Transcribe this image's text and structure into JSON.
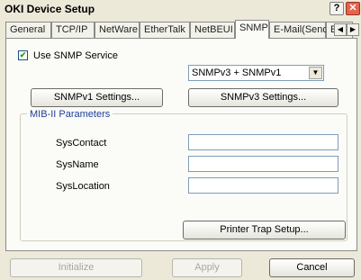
{
  "window": {
    "title": "OKI Device Setup",
    "help_glyph": "?",
    "close_glyph": "✕"
  },
  "tabs": [
    {
      "label": "General"
    },
    {
      "label": "TCP/IP"
    },
    {
      "label": "NetWare"
    },
    {
      "label": "EtherTalk"
    },
    {
      "label": "NetBEUI"
    },
    {
      "label": "SNMP"
    },
    {
      "label": "E-Mail(Send)"
    },
    {
      "label": "E-Mail("
    }
  ],
  "tab_scroll": {
    "left": "◀",
    "right": "▶"
  },
  "snmp": {
    "use_label": "Use SNMP Service",
    "use_checked": true,
    "check_glyph": "✔",
    "version_value": "SNMPv3 + SNMPv1",
    "dropdown_glyph": "▼",
    "v1_button": "SNMPv1 Settings...",
    "v3_button": "SNMPv3 Settings..."
  },
  "mib": {
    "group_label": "MIB-II Parameters",
    "contact_label": "SysContact",
    "contact_value": "",
    "name_label": "SysName",
    "name_value": "",
    "location_label": "SysLocation",
    "location_value": "",
    "trap_button": "Printer Trap Setup..."
  },
  "footer": {
    "initialize": "Initialize",
    "apply": "Apply",
    "cancel": "Cancel"
  },
  "colors": {
    "window_bg": "#ece9d8",
    "group_label": "#1e3f9c",
    "close_button": "#e4644c"
  }
}
